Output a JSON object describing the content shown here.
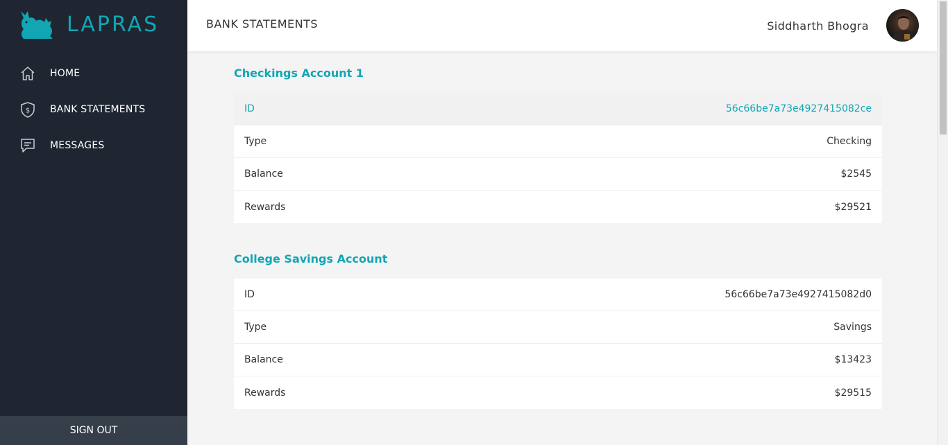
{
  "brand": {
    "name": "LAPRAS",
    "accent": "#12a6b5"
  },
  "sidebar": {
    "items": [
      {
        "label": "HOME",
        "icon": "home-icon"
      },
      {
        "label": "BANK STATEMENTS",
        "icon": "shield-dollar-icon"
      },
      {
        "label": "MESSAGES",
        "icon": "message-icon"
      }
    ],
    "signout_label": "SIGN OUT"
  },
  "header": {
    "title": "BANK STATEMENTS",
    "user_name": "Siddharth Bhogra"
  },
  "accounts": [
    {
      "title": "Checkings Account 1",
      "rows": [
        {
          "label": "ID",
          "value": "56c66be7a73e4927415082ce"
        },
        {
          "label": "Type",
          "value": "Checking"
        },
        {
          "label": "Balance",
          "value": "$2545"
        },
        {
          "label": "Rewards",
          "value": "$29521"
        }
      ]
    },
    {
      "title": "College Savings Account",
      "rows": [
        {
          "label": "ID",
          "value": "56c66be7a73e4927415082d0"
        },
        {
          "label": "Type",
          "value": "Savings"
        },
        {
          "label": "Balance",
          "value": "$13423"
        },
        {
          "label": "Rewards",
          "value": "$29515"
        }
      ]
    }
  ]
}
